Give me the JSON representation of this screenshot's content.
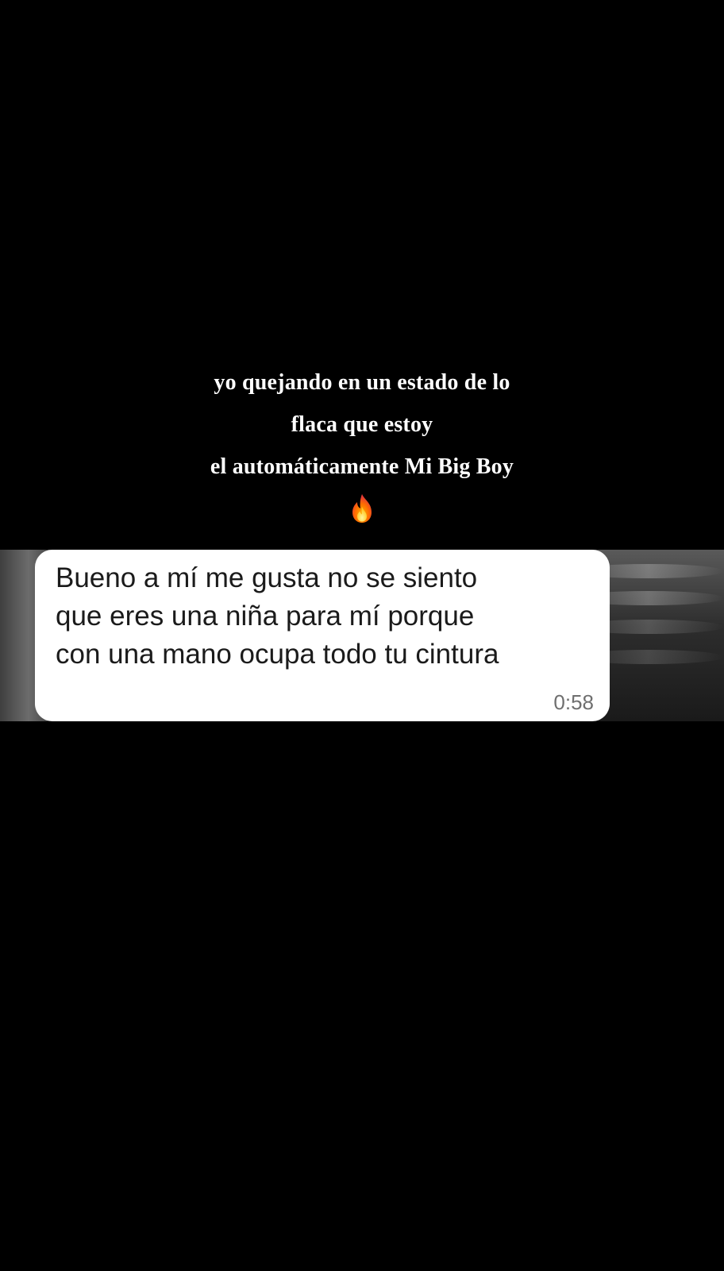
{
  "caption": {
    "lines": [
      "yo quejando en un estado de lo",
      "flaca que estoy",
      "el automáticamente Mi Big Boy"
    ],
    "emoji_icon": "fire-icon"
  },
  "message": {
    "lines": [
      "Bueno a mí me gusta no se siento",
      "que eres una niña para mí porque",
      "con una mano ocupa todo tu cintura"
    ],
    "time": "0:58"
  },
  "colors": {
    "background": "#000000",
    "caption_text": "#ffffff",
    "bubble": "#ffffff",
    "message_text": "#1b1b1b",
    "timestamp": "#6f6f6f"
  }
}
